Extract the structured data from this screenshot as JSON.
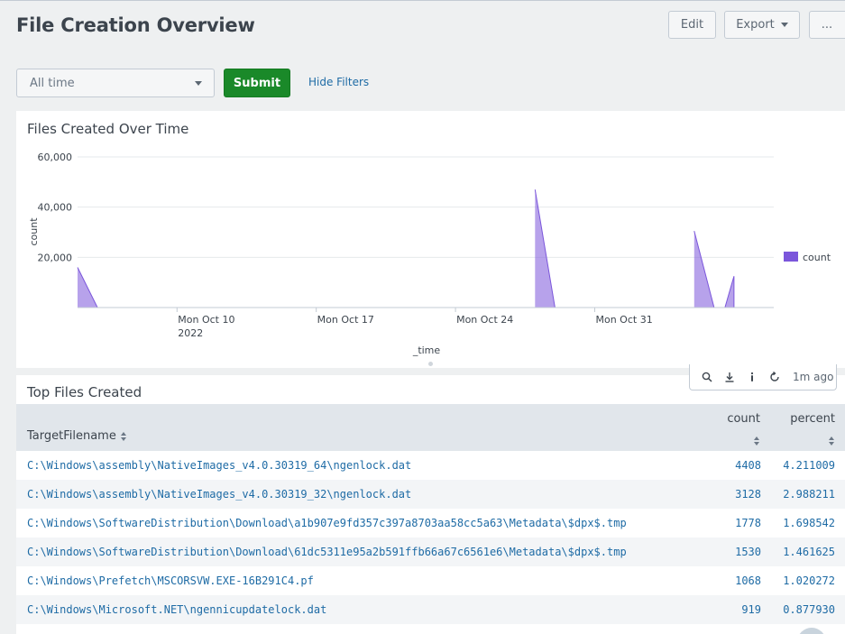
{
  "header": {
    "title": "File Creation Overview",
    "edit_label": "Edit",
    "export_label": "Export",
    "more_label": "..."
  },
  "filters": {
    "time_range": "All time",
    "submit_label": "Submit",
    "hide_filters_label": "Hide Filters"
  },
  "chart_panel": {
    "title": "Files Created Over Time",
    "legend_label": "count",
    "series_color": "#7b56db"
  },
  "chart_data": {
    "type": "area",
    "title": "",
    "xlabel": "_time",
    "ylabel": "count",
    "ylim": [
      0,
      60000
    ],
    "yticks": [
      "60,000",
      "40,000",
      "20,000"
    ],
    "xticks": [
      {
        "label": "Mon Oct 10",
        "sublabel": "2022",
        "date": "2022-10-10"
      },
      {
        "label": "Mon Oct 17",
        "sublabel": "",
        "date": "2022-10-17"
      },
      {
        "label": "Mon Oct 24",
        "sublabel": "",
        "date": "2022-10-24"
      },
      {
        "label": "Mon Oct 31",
        "sublabel": "",
        "date": "2022-10-31"
      }
    ],
    "xlim": [
      "2022-10-05",
      "2022-11-09"
    ],
    "legend": "right",
    "grid": true,
    "series": [
      {
        "name": "count",
        "segments": [
          [
            {
              "x": "2022-10-05",
              "y": 16000
            },
            {
              "x": "2022-10-06",
              "y": 0
            },
            {
              "x": "2022-10-27",
              "y": 0
            }
          ],
          [
            {
              "x": "2022-10-28",
              "y": 47000
            },
            {
              "x": "2022-10-29",
              "y": 0
            },
            {
              "x": "2022-11-04",
              "y": 0
            }
          ],
          [
            {
              "x": "2022-11-05",
              "y": 30500
            },
            {
              "x": "2022-11-06",
              "y": 0
            }
          ],
          [
            {
              "x": "2022-11-07",
              "y": 12500
            }
          ]
        ]
      }
    ]
  },
  "toolbar": {
    "search_icon": "search-icon",
    "export_icon": "download-icon",
    "inspect_icon": "info-icon",
    "refresh_icon": "refresh-icon",
    "last_refreshed": "1m ago"
  },
  "table_panel": {
    "title": "Top Files Created",
    "columns": {
      "file": "TargetFilename",
      "count": "count",
      "percent": "percent"
    },
    "rows": [
      {
        "file": "C:\\Windows\\assembly\\NativeImages_v4.0.30319_64\\ngenlock.dat",
        "count": "4408",
        "percent": "4.211009"
      },
      {
        "file": "C:\\Windows\\assembly\\NativeImages_v4.0.30319_32\\ngenlock.dat",
        "count": "3128",
        "percent": "2.988211"
      },
      {
        "file": "C:\\Windows\\SoftwareDistribution\\Download\\a1b907e9fd357c397a8703aa58cc5a63\\Metadata\\$dpx$.tmp",
        "count": "1778",
        "percent": "1.698542"
      },
      {
        "file": "C:\\Windows\\SoftwareDistribution\\Download\\61dc5311e95a2b591ffb66a67c6561e6\\Metadata\\$dpx$.tmp",
        "count": "1530",
        "percent": "1.461625"
      },
      {
        "file": "C:\\Windows\\Prefetch\\MSCORSVW.EXE-16B291C4.pf",
        "count": "1068",
        "percent": "1.020272"
      },
      {
        "file": "C:\\Windows\\Microsoft.NET\\ngennicupdatelock.dat",
        "count": "919",
        "percent": "0.877930"
      }
    ]
  }
}
